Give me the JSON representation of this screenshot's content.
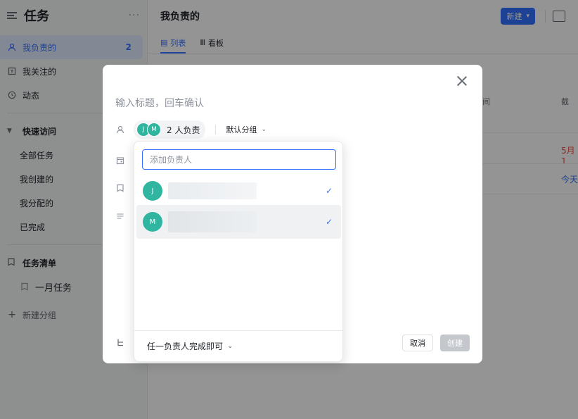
{
  "sidebar": {
    "title": "任务",
    "more": "···",
    "items": [
      {
        "label": "我负责的",
        "count": "2",
        "icon": "person-icon"
      },
      {
        "label": "我关注的",
        "icon": "follow-icon"
      },
      {
        "label": "动态",
        "icon": "clock-icon"
      }
    ],
    "quick_access": {
      "label": "快速访问",
      "items": [
        "全部任务",
        "我创建的",
        "我分配的",
        "已完成"
      ]
    },
    "task_lists": {
      "label": "任务清单",
      "items": [
        "一月任务"
      ]
    },
    "new_group": "新建分组"
  },
  "main": {
    "title": "我负责的",
    "new_button": "新建",
    "tabs": [
      {
        "label": "列表",
        "icon": "list-icon",
        "active": true
      },
      {
        "label": "看板",
        "icon": "board-icon",
        "active": false
      }
    ],
    "col_heads": [
      "间",
      "截"
    ],
    "rows": [
      {
        "date": "5月1",
        "color": "#f54a45"
      },
      {
        "date": "今天",
        "color": "#3370ff"
      }
    ]
  },
  "modal": {
    "title_placeholder": "输入标题，回车确认",
    "assignee_text": "2 人负责",
    "avatars": [
      "J",
      "M"
    ],
    "group": "默认分组",
    "cancel": "取消",
    "create": "创建"
  },
  "dropdown": {
    "search_placeholder": "添加负责人",
    "members": [
      {
        "initial": "J",
        "checked": true
      },
      {
        "initial": "M",
        "checked": true
      }
    ],
    "footer": "任一负责人完成即可"
  },
  "colors": {
    "accent": "#3370ff",
    "avatar": "#2fb5a0"
  }
}
